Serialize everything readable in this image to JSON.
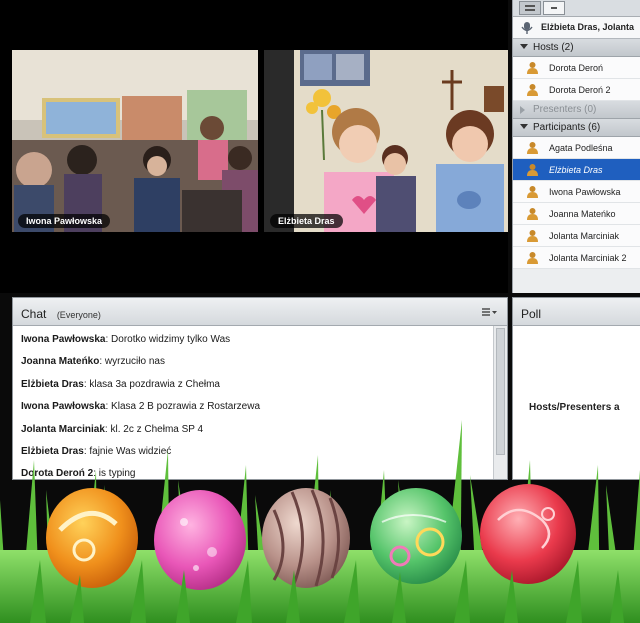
{
  "videos": [
    {
      "label": "Iwona Pawłowska"
    },
    {
      "label": "Elżbieta Dras"
    }
  ],
  "attendees": {
    "meeting_title": "Elżbieta Dras, Jolanta",
    "hosts": {
      "header": "Hosts (2)",
      "items": [
        "Dorota Deroń",
        "Dorota Deroń 2"
      ]
    },
    "presenters": {
      "header": "Presenters (0)"
    },
    "participants": {
      "header": "Participants (6)",
      "selected_index": 1,
      "items": [
        "Agata Podleśna",
        "Elżbieta Dras",
        "Iwona Pawłowska",
        "Joanna Mateńko",
        "Jolanta Marciniak",
        "Jolanta Marciniak 2"
      ]
    }
  },
  "chat": {
    "title": "Chat",
    "audience": "(Everyone)",
    "messages": [
      {
        "author": "Iwona Pawłowska",
        "text": "Dorotko widzimy tylko Was"
      },
      {
        "author": "Joanna Mateńko",
        "text": "wyrzuciło nas"
      },
      {
        "author": "Elżbieta Dras",
        "text": "klasa 3a pozdrawia z Chełma"
      },
      {
        "author": "Iwona Pawłowska",
        "text": "Klasa 2 B pozrawia z Rostarzewa"
      },
      {
        "author": "Jolanta Marciniak",
        "text": "kl. 2c z Chełma SP 4"
      },
      {
        "author": "Elżbieta Dras",
        "text": "fajnie Was widzieć"
      },
      {
        "author": "Dorota Deroń 2",
        "text": "is typing"
      }
    ]
  },
  "poll": {
    "title": "Poll",
    "body": "Hosts/Presenters a"
  },
  "colors": {
    "selection": "#1f5fbf",
    "pod_border": "#8f959b",
    "stage": "#000000"
  }
}
